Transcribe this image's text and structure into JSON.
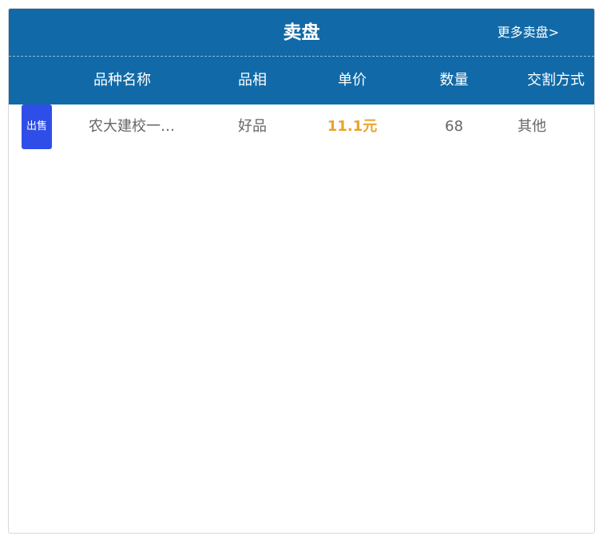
{
  "header": {
    "title": "卖盘",
    "more_link": "更多卖盘>"
  },
  "columns": {
    "name": "品种名称",
    "grade": "品相",
    "price": "单价",
    "quantity": "数量",
    "deal": "交割方式"
  },
  "rows": [
    {
      "badge": "出售",
      "name": "农大建校一…",
      "grade": "好品",
      "price": "11.1元",
      "quantity": "68",
      "deal": "其他"
    }
  ],
  "colors": {
    "header_bg": "#116aa7",
    "badge_bg": "#2f4ee8",
    "price": "#e8a42c"
  }
}
